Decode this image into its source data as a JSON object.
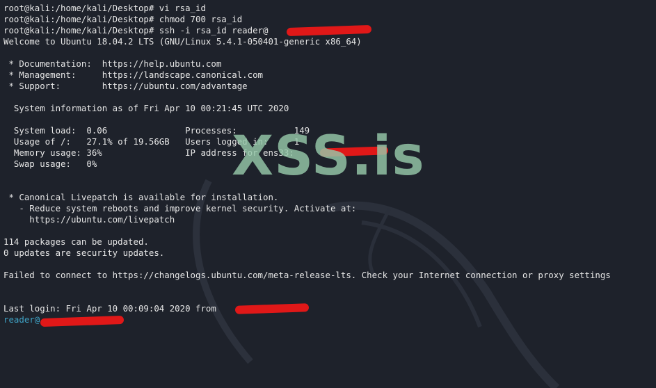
{
  "colors": {
    "background": "#1e222b",
    "text": "#e6e6e6",
    "prompt_user": "#3fa3c6",
    "redaction": "#e01818",
    "watermark": "#96c8aa"
  },
  "lines": [
    "root@kali:/home/kali/Desktop# vi rsa_id",
    "root@kali:/home/kali/Desktop# chmod 700 rsa_id",
    "root@kali:/home/kali/Desktop# ssh -i rsa_id reader@",
    "Welcome to Ubuntu 18.04.2 LTS (GNU/Linux 5.4.1-050401-generic x86_64)",
    "",
    " * Documentation:  https://help.ubuntu.com",
    " * Management:     https://landscape.canonical.com",
    " * Support:        https://ubuntu.com/advantage",
    "",
    "  System information as of Fri Apr 10 00:21:45 UTC 2020",
    "",
    "  System load:  0.06               Processes:           149",
    "  Usage of /:   27.1% of 19.56GB   Users logged in:     1",
    "  Memory usage: 36%                IP address for ens33:",
    "  Swap usage:   0%",
    "",
    "",
    " * Canonical Livepatch is available for installation.",
    "   - Reduce system reboots and improve kernel security. Activate at:",
    "     https://ubuntu.com/livepatch",
    "",
    "114 packages can be updated.",
    "0 updates are security updates.",
    "",
    "Failed to connect to https://changelogs.ubuntu.com/meta-release-lts. Check your Internet connection or proxy settings",
    "",
    "",
    "Last login: Fri Apr 10 00:09:04 2020 from"
  ],
  "remote_prompt": "reader@",
  "watermark": "XSS.is"
}
